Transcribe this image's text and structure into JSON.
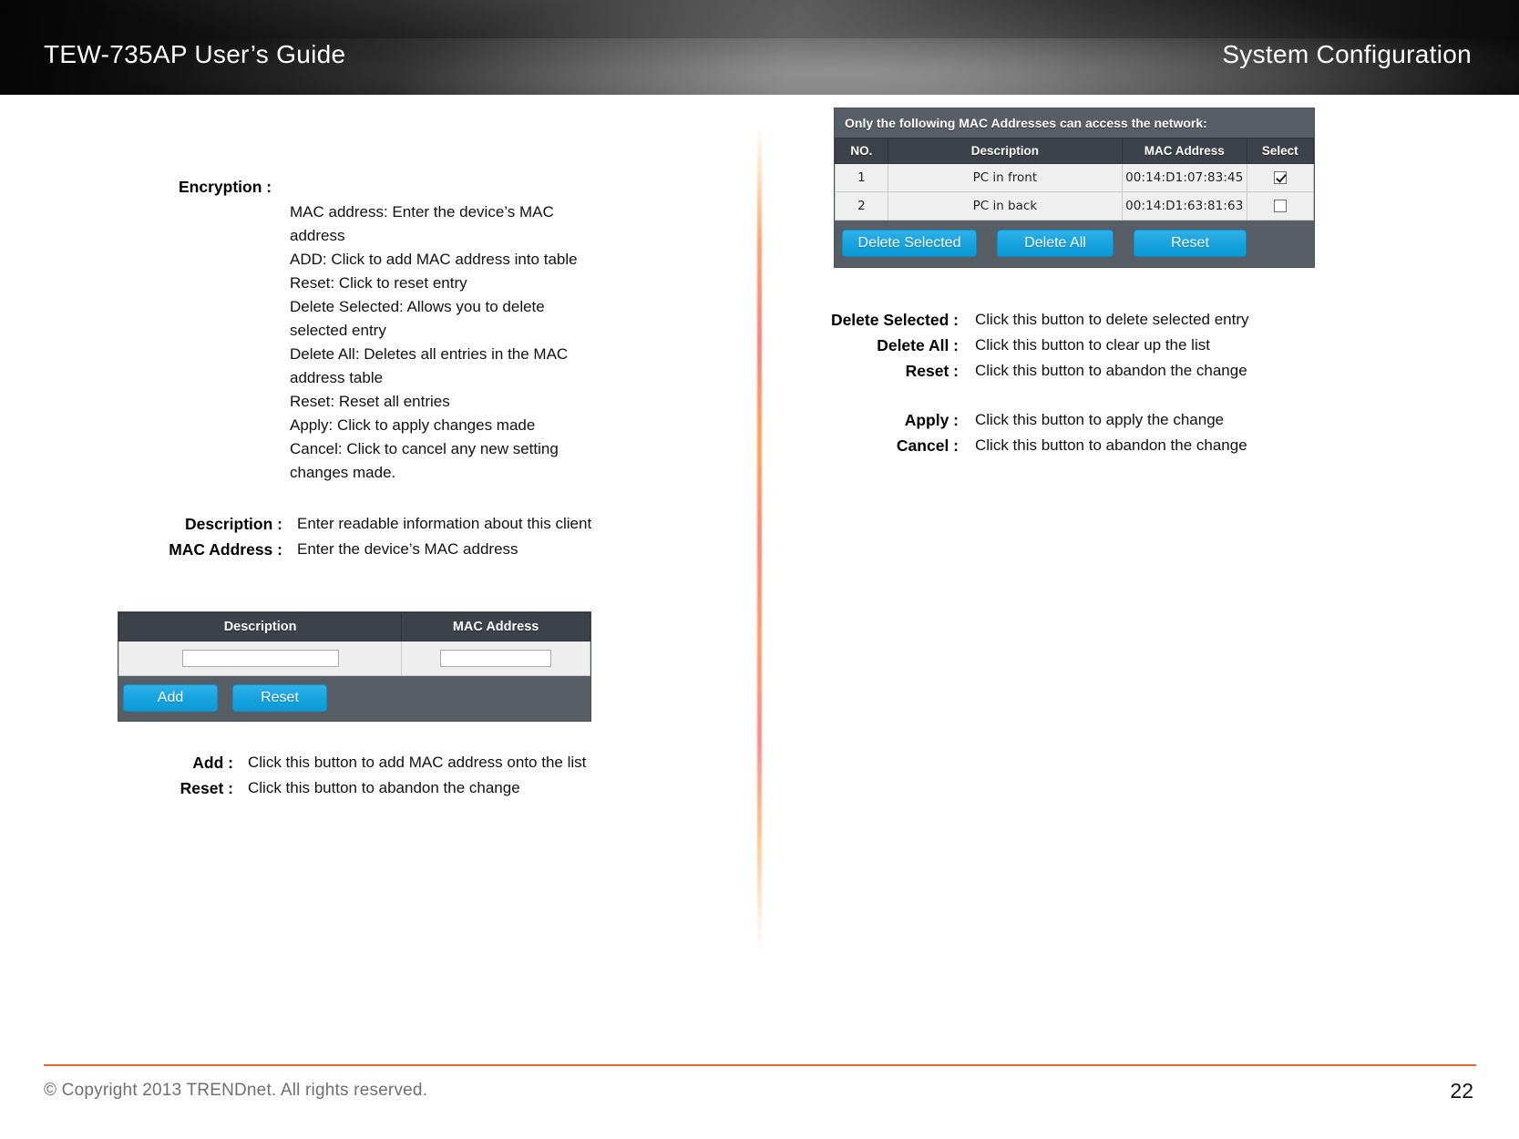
{
  "header": {
    "left_title": "TEW-735AP User’s Guide",
    "right_title": "System Configuration"
  },
  "left_column": {
    "encryption_term": "Encryption :",
    "encryption_lines": [
      "MAC address: Enter the device’s MAC",
      "address",
      "ADD: Click to add MAC address into table",
      "Reset: Click to reset entry",
      "Delete Selected: Allows you to delete",
      "selected entry",
      "Delete All: Deletes all entries in the MAC",
      "address table",
      "Reset: Reset all entries",
      "Apply: Click to apply changes made",
      "Cancel: Click to cancel any new setting",
      "changes made."
    ],
    "definitions": [
      {
        "term": "Description :",
        "desc": "Enter readable information about this client"
      },
      {
        "term": "MAC Address :",
        "desc": "Enter the device’s MAC address"
      }
    ],
    "definitions2": [
      {
        "term": "Add :",
        "desc": "Click this button to add MAC address onto the list"
      },
      {
        "term": "Reset :",
        "desc": "Click this button to abandon the change"
      }
    ]
  },
  "add_form_screenshot": {
    "columns": [
      "Description",
      "MAC Address"
    ],
    "fields": {
      "description_value": "",
      "mac_value": ""
    },
    "buttons": [
      "Add",
      "Reset"
    ],
    "accent_color": "#16a3de",
    "header_bg": "#3d424a",
    "frame_bg": "#585e66"
  },
  "mac_list_screenshot": {
    "caption": "Only the following MAC Addresses can access the network:",
    "columns": [
      "NO.",
      "Description",
      "MAC Address",
      "Select"
    ],
    "rows": [
      {
        "no": "1",
        "description": "PC in front",
        "mac": "00:14:D1:07:83:45",
        "selected": true
      },
      {
        "no": "2",
        "description": "PC in back",
        "mac": "00:14:D1:63:81:63",
        "selected": false
      }
    ],
    "buttons": [
      "Delete Selected",
      "Delete All",
      "Reset"
    ],
    "accent_color": "#16a3de",
    "header_bg": "#3d424a",
    "frame_bg": "#585e66"
  },
  "right_column": {
    "definitions": [
      {
        "term": "Delete Selected :",
        "desc": "Click this button to delete selected entry"
      },
      {
        "term": "Delete All :",
        "desc": "Click this button to clear up the list"
      },
      {
        "term": "Reset :",
        "desc": "Click this button to abandon the change"
      },
      {
        "term": "Apply :",
        "desc": "Click this button to apply the change"
      },
      {
        "term": "Cancel :",
        "desc": "Click this button to abandon the change"
      }
    ]
  },
  "footer": {
    "copyright": "© Copyright 2013 TRENDnet. All rights reserved.",
    "page_number": "22",
    "rule_color": "#e4662a"
  }
}
